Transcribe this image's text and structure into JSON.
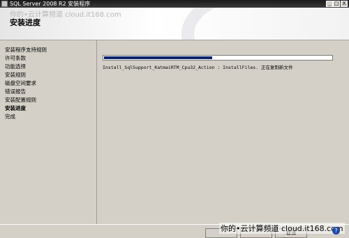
{
  "window": {
    "title": "SQL Server 2008 R2 安装程序",
    "controls": [
      "_",
      "□",
      "X"
    ]
  },
  "header": {
    "title": "安装进度",
    "watermark": "你的•云计算频道  cloud.it168.com"
  },
  "sidebar": {
    "items": [
      {
        "label": "安装程序支持规则"
      },
      {
        "label": "许可条款"
      },
      {
        "label": "功能选择"
      },
      {
        "label": "安装规则"
      },
      {
        "label": "磁盘空间要求"
      },
      {
        "label": "错误报告"
      },
      {
        "label": "安装配置规则"
      },
      {
        "label": "安装进度",
        "active": true
      },
      {
        "label": "完成"
      }
    ]
  },
  "main": {
    "progress_percent": 48,
    "status_text": "Install_SqlSupport_KatmaiRTM_Cpu32_Action  :  InstallFiles. 正在复制新文件"
  },
  "footer": {
    "buttons": [
      "",
      "",
      "取消"
    ],
    "watermark": "你的•云计算频道  cloud.it168.com",
    "help_label": "?"
  },
  "colors": {
    "progress_fill": "#0a246a",
    "dialog_bg": "#d4d0c8"
  }
}
